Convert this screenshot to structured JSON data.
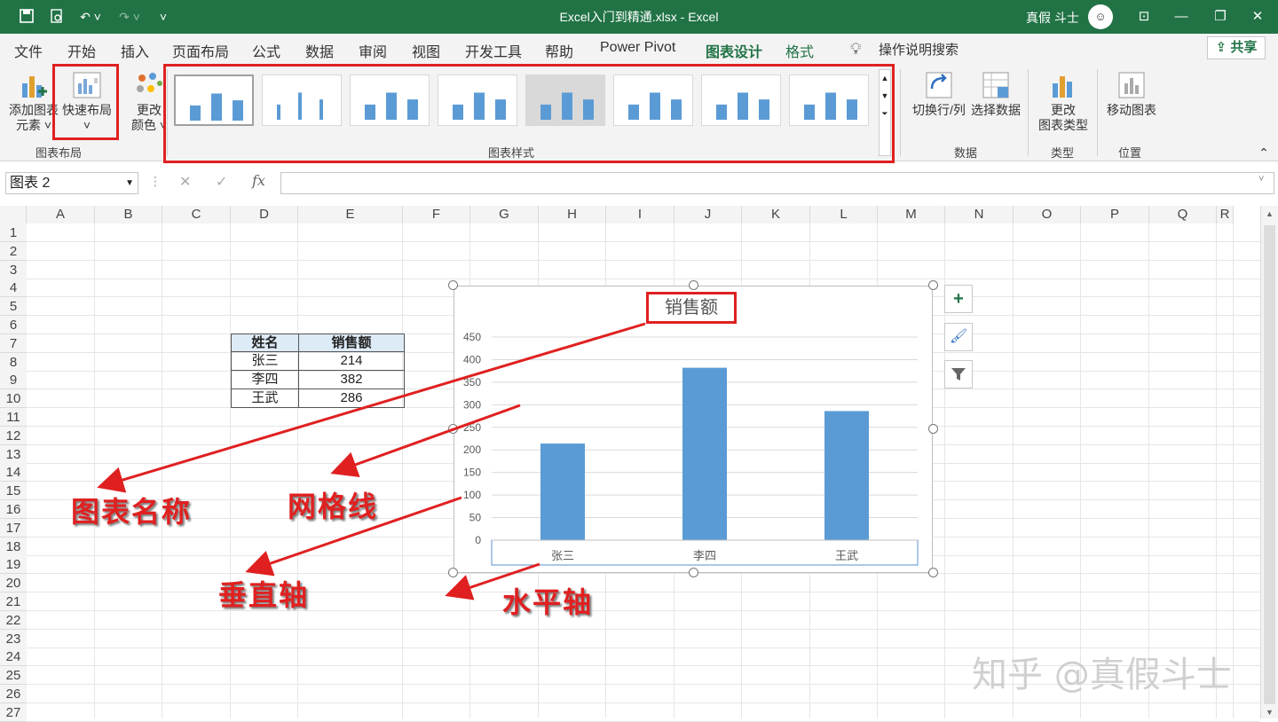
{
  "titlebar": {
    "doc_title": "Excel入门到精通.xlsx  -  Excel",
    "user": "真假 斗士",
    "icons": [
      "save-icon",
      "print-preview-icon",
      "undo-icon",
      "redo-icon",
      "customize-icon"
    ],
    "window_buttons": [
      "ribbon-display-icon",
      "minimize-icon",
      "restore-icon",
      "close-icon"
    ]
  },
  "tabs": [
    "文件",
    "开始",
    "插入",
    "页面布局",
    "公式",
    "数据",
    "审阅",
    "视图",
    "开发工具",
    "帮助",
    "Power Pivot",
    "图表设计",
    "格式"
  ],
  "active_tab": "图表设计",
  "tell_me": "操作说明搜索",
  "share": "共享",
  "ribbon": {
    "add_element": [
      "添加图表",
      "元素 ˅"
    ],
    "quick_layout": [
      "快速布局",
      "˅"
    ],
    "change_color": [
      "更改",
      "颜色 ˅"
    ],
    "group_layout": "图表布局",
    "group_styles": "图表样式",
    "switch_row_col": "切换行/列",
    "select_data": "选择数据",
    "group_data": "数据",
    "change_type": [
      "更改",
      "图表类型"
    ],
    "group_type": "类型",
    "move_chart": "移动图表",
    "group_location": "位置"
  },
  "formula_bar": {
    "name_box": "图表 2",
    "fx": "fx",
    "value": ""
  },
  "columns": [
    "A",
    "B",
    "C",
    "D",
    "E",
    "F",
    "G",
    "H",
    "I",
    "J",
    "K",
    "L",
    "M",
    "N",
    "O",
    "P",
    "Q",
    "R"
  ],
  "rows": [
    "1",
    "2",
    "3",
    "4",
    "5",
    "6",
    "7",
    "8",
    "9",
    "10",
    "11",
    "12",
    "13",
    "14",
    "15",
    "16",
    "17",
    "18",
    "19",
    "20",
    "21",
    "22",
    "23",
    "24",
    "25",
    "26",
    "27"
  ],
  "table": {
    "headers": [
      "姓名",
      "销售额"
    ],
    "rows": [
      [
        "张三",
        "214"
      ],
      [
        "李四",
        "382"
      ],
      [
        "王武",
        "286"
      ]
    ]
  },
  "chart_data": {
    "type": "bar",
    "title": "销售额",
    "categories": [
      "张三",
      "李四",
      "王武"
    ],
    "values": [
      214,
      382,
      286
    ],
    "ylim": [
      0,
      450
    ],
    "yticks": [
      "0",
      "50",
      "100",
      "150",
      "200",
      "250",
      "300",
      "350",
      "400",
      "450"
    ],
    "grid": true,
    "bar_color": "#5b9bd5"
  },
  "annotations": {
    "title_label": "图表名称",
    "grid_label": "网格线",
    "vaxis_label": "垂直轴",
    "haxis_label": "水平轴"
  },
  "watermark": "知乎 @真假斗士",
  "colors": {
    "accent": "#217346",
    "annotation": "#e02020"
  }
}
